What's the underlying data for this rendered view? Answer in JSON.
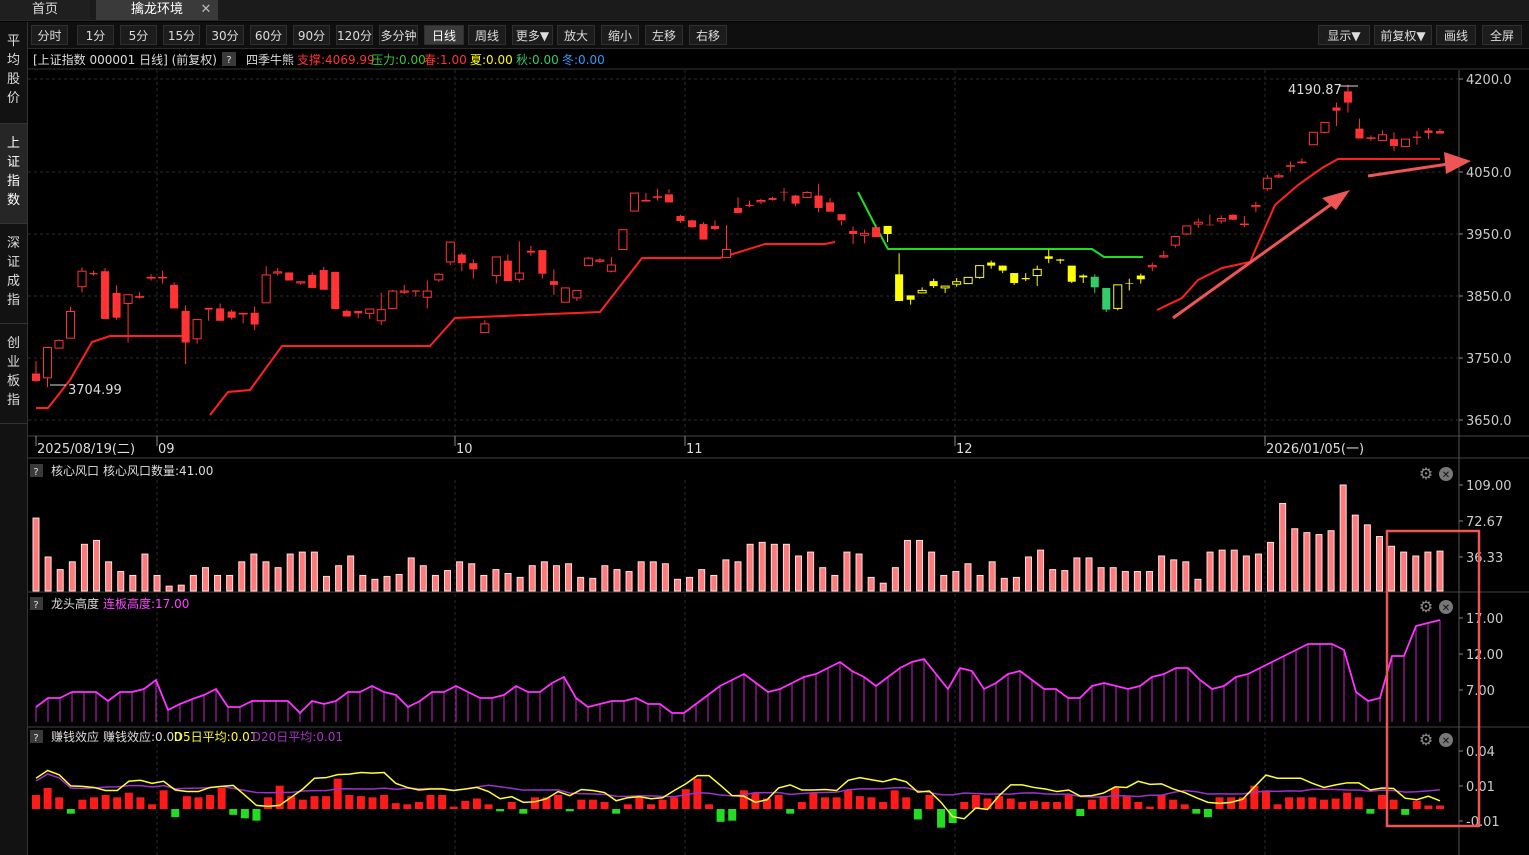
{
  "tabs": {
    "home": "首页",
    "env": "擒龙环境",
    "close": "✕"
  },
  "toolbar": {
    "left": [
      "分时",
      "1分",
      "5分",
      "15分",
      "30分",
      "60分",
      "90分",
      "120分",
      "多分钟",
      "日线",
      "周线",
      "更多▼",
      "放大",
      "缩小",
      "左移",
      "右移"
    ],
    "active": "日线",
    "right": [
      "显示▼",
      "前复权▼",
      "画线",
      "全屏"
    ]
  },
  "sidebar": [
    {
      "label": "平\n均\n股\n价",
      "active": false
    },
    {
      "label": "上\n证\n指\n数",
      "active": true
    },
    {
      "label": "深\n证\n成\n指",
      "active": false
    },
    {
      "label": "创\n业\n板\n指",
      "active": false
    }
  ],
  "main_header": {
    "title": "[上证指数 000001 日线] (前复权)",
    "help": "?",
    "indicator": "四季牛熊",
    "items": [
      {
        "text": "支撑:4069.99",
        "color": "#ff3333"
      },
      {
        "text": "压力:0.00",
        "color": "#33cc33"
      },
      {
        "text": "春:1.00",
        "color": "#ff3333"
      },
      {
        "text": "夏:0.00",
        "color": "#ffff00"
      },
      {
        "text": "秋:0.00",
        "color": "#33cc66"
      },
      {
        "text": "冬:0.00",
        "color": "#3399ff"
      }
    ]
  },
  "date_axis": {
    "labels": [
      "2025/08/19(二)",
      "09",
      "10",
      "11",
      "12",
      "2026/01/05(一)"
    ]
  },
  "sub1_header": {
    "help": "?",
    "name": "核心风口",
    "value_label": "核心风口数量:41.00"
  },
  "sub2_header": {
    "help": "?",
    "name": "龙头高度",
    "value_label": "连板高度:17.00"
  },
  "sub3_header": {
    "help": "?",
    "name": "赚钱效应",
    "value_label": "赚钱效应:0.00",
    "d5": "D5日平均:0.01",
    "d20": "D20日平均:0.01"
  },
  "icons": {
    "gear": "⚙",
    "close": "✕"
  },
  "chart_data": [
    {
      "type": "candlestick",
      "title": "[上证指数 000001 日线] (前复权)",
      "y_ticks": [
        "4200.0",
        "4050.0",
        "3950.0",
        "3850.0",
        "3750.0",
        "3650.0"
      ],
      "ylim": [
        3630,
        4230
      ],
      "annotations": [
        {
          "text": "4190.87",
          "kind": "high"
        },
        {
          "text": "3704.99",
          "kind": "low"
        }
      ],
      "ohlc": [
        [
          3725.0,
          3745.0,
          3711.0,
          3713.0
        ],
        [
          3718.0,
          3768.0,
          3703.0,
          3767.0
        ],
        [
          3766.0,
          3780.0,
          3768.0,
          3778.0
        ],
        [
          3782.0,
          3833.0,
          3785.0,
          3825.0
        ],
        [
          3865.0,
          3896.0,
          3856.0,
          3890.0
        ],
        [
          3887.0,
          3891.0,
          3883.0,
          3885.0
        ],
        [
          3890.0,
          3895.0,
          3815.0,
          3813.0
        ],
        [
          3855.0,
          3867.0,
          3812.0,
          3815.0
        ],
        [
          3838.0,
          3839.0,
          3775.0,
          3852.0
        ],
        [
          3848.0,
          3856.0,
          3846.0,
          3849.0
        ],
        [
          3879.0,
          3885.0,
          3875.0,
          3880.0
        ],
        [
          3880.0,
          3891.0,
          3870.0,
          3880.0
        ],
        [
          3868.0,
          3872.0,
          3832.0,
          3830.0
        ],
        [
          3826.0,
          3835.0,
          3740.0,
          3775.0
        ],
        [
          3781.0,
          3808.0,
          3773.0,
          3812.0
        ],
        [
          3831.0,
          3828.0,
          3810.0,
          3828.0
        ],
        [
          3830.0,
          3838.0,
          3810.0,
          3810.0
        ],
        [
          3825.0,
          3828.0,
          3812.0,
          3815.0
        ],
        [
          3821.0,
          3820.0,
          3806.0,
          3822.0
        ],
        [
          3823.0,
          3833.0,
          3795.0,
          3804.0
        ],
        [
          3839.0,
          3898.0,
          3850.0,
          3884.0
        ],
        [
          3887.0,
          3895.0,
          3883.0,
          3889.0
        ],
        [
          3888.0,
          3888.0,
          3880.0,
          3875.0
        ],
        [
          3871.0,
          3872.0,
          3868.0,
          3873.0
        ],
        [
          3884.0,
          3888.0,
          3863.0,
          3863.0
        ],
        [
          3892.0,
          3897.0,
          3861.0,
          3860.0
        ],
        [
          3889.0,
          3885.0,
          3858.0,
          3829.0
        ],
        [
          3826.0,
          3828.0,
          3817.0,
          3817.0
        ],
        [
          3826.0,
          3822.0,
          3814.0,
          3822.0
        ],
        [
          3822.0,
          3826.0,
          3813.0,
          3829.0
        ],
        [
          3810.0,
          3855.0,
          3803.0,
          3828.0
        ],
        [
          3830.0,
          3860.0,
          3855.0,
          3858.0
        ],
        [
          3856.0,
          3868.0,
          3853.0,
          3858.0
        ],
        [
          3859.0,
          3858.0,
          3849.0,
          3857.0
        ],
        [
          3848.0,
          3875.0,
          3830.0,
          3858.0
        ],
        [
          3876.0,
          3887.0,
          3873.0,
          3885.0
        ],
        [
          3905.0,
          3938.0,
          3900.0,
          3937.0
        ],
        [
          3917.0,
          3920.0,
          3890.0,
          3903.0
        ],
        [
          3903.0,
          3909.0,
          3878.0,
          3893.0
        ],
        [
          3791.0,
          3811.0,
          3794.0,
          3805.0
        ],
        [
          3883.0,
          3894.0,
          3870.0,
          3913.0
        ],
        [
          3907.0,
          3917.0,
          3900.0,
          3874.0
        ],
        [
          3877.0,
          3938.0,
          3872.0,
          3887.0
        ],
        [
          3923.0,
          3931.0,
          3915.0,
          3920.0
        ],
        [
          3924.0,
          3911.0,
          3878.0,
          3886.0
        ],
        [
          3874.0,
          3893.0,
          3852.0,
          3868.0
        ],
        [
          3840.0,
          3864.0,
          3859.0,
          3863.0
        ],
        [
          3847.0,
          3850.0,
          3842.0,
          3859.0
        ],
        [
          3899.0,
          3913.0,
          3898.0,
          3911.0
        ],
        [
          3906.0,
          3911.0,
          3903.0,
          3908.0
        ],
        [
          3890.0,
          3913.0,
          3888.0,
          3900.0
        ],
        [
          3925.0,
          3950.0,
          3925.0,
          3957.0
        ],
        [
          3987.0,
          4012.0,
          4004.0,
          4016.0
        ],
        [
          4004.0,
          4016.0,
          4003.0,
          4004.0
        ],
        [
          4010.0,
          4023.0,
          4004.0,
          4010.0
        ],
        [
          4014.0,
          4022.0,
          4016.0,
          4001.0
        ],
        [
          3979.0,
          3981.0,
          3968.0,
          3971.0
        ],
        [
          3972.0,
          3973.0,
          3960.0,
          3961.0
        ],
        [
          3966.0,
          3969.0,
          3945.0,
          3941.0
        ],
        [
          3963.0,
          3972.0,
          3956.0,
          3958.0
        ],
        [
          3912.0,
          3964.0,
          3918.0,
          3925.0
        ],
        [
          3992.0,
          4009.0,
          3990.0,
          3984.0
        ],
        [
          3997.0,
          4004.0,
          3993.0,
          3995.0
        ],
        [
          4002.0,
          4007.0,
          3998.0,
          4004.0
        ],
        [
          4008.0,
          4010.0,
          4004.0,
          4005.0
        ],
        [
          4018.0,
          4024.0,
          4003.0,
          4017.0
        ],
        [
          4012.0,
          4013.0,
          3995.0,
          3999.0
        ],
        [
          4009.0,
          4019.0,
          4008.0,
          4017.0
        ],
        [
          4012.0,
          4031.0,
          3985.0,
          3992.0
        ],
        [
          4001.0,
          4008.0,
          3990.0,
          3986.0
        ],
        [
          3982.0,
          3971.0,
          3964.0,
          3972.0
        ],
        [
          3955.0,
          3962.0,
          3934.0,
          3950.0
        ],
        [
          3948.0,
          3957.0,
          3935.0,
          3951.0
        ],
        [
          3961.0,
          3962.0,
          3950.0,
          3945.0
        ],
        [
          3963.0,
          3962.0,
          3937.0,
          3950.0
        ],
        [
          3885.0,
          3919.0,
          3842.0,
          3842.0
        ],
        [
          3851.0,
          3849.0,
          3836.0,
          3844.0
        ],
        [
          3855.0,
          3864.0,
          3856.0,
          3859.0
        ],
        [
          3874.0,
          3878.0,
          3863.0,
          3866.0
        ],
        [
          3863.0,
          3865.0,
          3855.0,
          3866.0
        ],
        [
          3869.0,
          3879.0,
          3865.0,
          3873.0
        ],
        [
          3870.0,
          3879.0,
          3871.0,
          3880.0
        ],
        [
          3880.0,
          3899.0,
          3878.0,
          3899.0
        ],
        [
          3904.0,
          3907.0,
          3894.0,
          3899.0
        ],
        [
          3899.0,
          3899.0,
          3887.0,
          3891.0
        ],
        [
          3887.0,
          3887.0,
          3868.0,
          3871.0
        ],
        [
          3879.0,
          3887.0,
          3874.0,
          3877.0
        ],
        [
          3883.0,
          3899.0,
          3866.0,
          3893.0
        ],
        [
          3914.0,
          3925.0,
          3903.0,
          3910.0
        ],
        [
          3909.0,
          3910.0,
          3902.0,
          3907.0
        ],
        [
          3899.0,
          3898.0,
          3871.0,
          3873.0
        ],
        [
          3883.0,
          3885.0,
          3871.0,
          3880.0
        ],
        [
          3881.0,
          3885.0,
          3855.0,
          3864.0
        ],
        [
          3863.0,
          3856.0,
          3824.0,
          3828.0
        ],
        [
          3830.0,
          3865.0,
          3827.0,
          3868.0
        ],
        [
          3871.0,
          3878.0,
          3859.0,
          3870.0
        ],
        [
          3883.0,
          3886.0,
          3870.0,
          3877.0
        ],
        [
          3897.0,
          3904.0,
          3890.0,
          3899.0
        ],
        [
          3913.0,
          3923.0,
          3911.0,
          3915.0
        ],
        [
          3932.0,
          3944.0,
          3928.0,
          3946.0
        ],
        [
          3950.0,
          3962.0,
          3948.0,
          3963.0
        ],
        [
          3966.0,
          3975.0,
          3960.0,
          3969.0
        ],
        [
          3965.0,
          3981.0,
          3965.0,
          3964.0
        ],
        [
          3971.0,
          3980.0,
          3967.0,
          3975.0
        ],
        [
          3981.0,
          3982.0,
          3973.0,
          3973.0
        ],
        [
          3966.0,
          3979.0,
          3961.0,
          3966.0
        ],
        [
          3994.0,
          4002.0,
          3985.0,
          3996.0
        ],
        [
          4023.0,
          4045.0,
          4020.0,
          4040.0
        ],
        [
          4042.0,
          4048.0,
          4040.0,
          4044.0
        ],
        [
          4060.0,
          4067.0,
          4051.0,
          4060.0
        ],
        [
          4065.0,
          4072.0,
          4063.0,
          4066.0
        ],
        [
          4094.0,
          4104.0,
          4094.0,
          4114.0
        ],
        [
          4114.0,
          4130.0,
          4112.0,
          4130.0
        ],
        [
          4154.0,
          4162.0,
          4124.0,
          4149.0
        ],
        [
          4180.0,
          4191.0,
          4146.0,
          4162.0
        ],
        [
          4120.0,
          4136.0,
          4104.0,
          4104.0
        ],
        [
          4105.0,
          4109.0,
          4100.0,
          4105.0
        ],
        [
          4101.0,
          4117.0,
          4100.0,
          4110.0
        ],
        [
          4103.0,
          4114.0,
          4084.0,
          4092.0
        ],
        [
          4091.0,
          4102.0,
          4094.0,
          4103.0
        ],
        [
          4107.0,
          4116.0,
          4094.0,
          4105.0
        ],
        [
          4117.0,
          4121.0,
          4103.0,
          4113.0
        ],
        [
          4116.0,
          4120.0,
          4112.0,
          4112.0
        ]
      ]
    },
    {
      "type": "bar",
      "title": "核心风口",
      "y_ticks": [
        "109.00",
        "72.67",
        "36.33"
      ],
      "ylim": [
        0,
        109
      ]
    },
    {
      "type": "line",
      "title": "龙头高度",
      "y_ticks": [
        "17.00",
        "12.00",
        "7.00"
      ],
      "ylim": [
        0,
        18
      ]
    },
    {
      "type": "bar",
      "title": "赚钱效应",
      "y_ticks": [
        "0.04",
        "0.01",
        "-0.01"
      ],
      "ylim": [
        -0.015,
        0.045
      ]
    }
  ]
}
